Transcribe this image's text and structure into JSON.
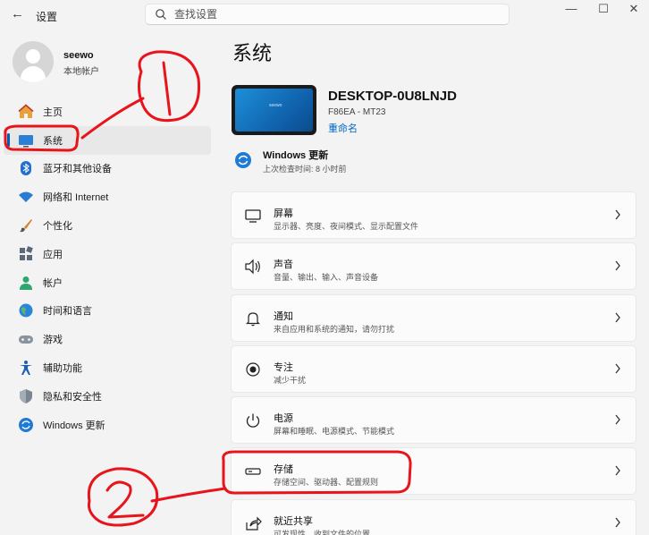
{
  "window": {
    "title": "设置",
    "back_glyph": "←",
    "controls": {
      "minimize": "—",
      "maximize": "☐",
      "close": "✕"
    }
  },
  "search": {
    "placeholder": "查找设置",
    "value": ""
  },
  "profile": {
    "name": "seewo",
    "account_type": "本地帐户"
  },
  "sidebar": {
    "items": [
      {
        "label": "主页",
        "icon": "home-icon"
      },
      {
        "label": "系统",
        "icon": "system-icon",
        "selected": true
      },
      {
        "label": "蓝牙和其他设备",
        "icon": "bluetooth-icon"
      },
      {
        "label": "网络和 Internet",
        "icon": "wifi-icon"
      },
      {
        "label": "个性化",
        "icon": "brush-icon"
      },
      {
        "label": "应用",
        "icon": "apps-icon"
      },
      {
        "label": "帐户",
        "icon": "account-icon"
      },
      {
        "label": "时间和语言",
        "icon": "globe-icon"
      },
      {
        "label": "游戏",
        "icon": "gamepad-icon"
      },
      {
        "label": "辅助功能",
        "icon": "accessibility-icon"
      },
      {
        "label": "隐私和安全性",
        "icon": "shield-icon"
      },
      {
        "label": "Windows 更新",
        "icon": "update-icon"
      }
    ]
  },
  "main": {
    "title": "系统",
    "device": {
      "thumb_brand": "seewo",
      "name": "DESKTOP-0U8LNJD",
      "model": "F86EA - MT23",
      "rename_label": "重命名"
    },
    "windows_update": {
      "title": "Windows 更新",
      "subtitle": "上次检查时间: 8 小时前"
    },
    "cards": [
      {
        "title": "屏幕",
        "subtitle": "显示器、亮度、夜间模式、显示配置文件",
        "icon": "monitor-icon"
      },
      {
        "title": "声音",
        "subtitle": "音量、输出、输入、声音设备",
        "icon": "speaker-icon"
      },
      {
        "title": "通知",
        "subtitle": "来自应用和系统的通知，请勿打扰",
        "icon": "bell-icon"
      },
      {
        "title": "专注",
        "subtitle": "减少干扰",
        "icon": "focus-icon"
      },
      {
        "title": "电源",
        "subtitle": "屏幕和睡眠、电源模式、节能模式",
        "icon": "power-icon"
      },
      {
        "title": "存储",
        "subtitle": "存储空间、驱动器、配置规则",
        "icon": "storage-icon"
      },
      {
        "title": "就近共享",
        "subtitle": "可发现性、收到文件的位置",
        "icon": "share-icon"
      }
    ]
  },
  "colors": {
    "accent": "#005fb8",
    "annotation": "#e8141b",
    "link": "#0067c0"
  }
}
